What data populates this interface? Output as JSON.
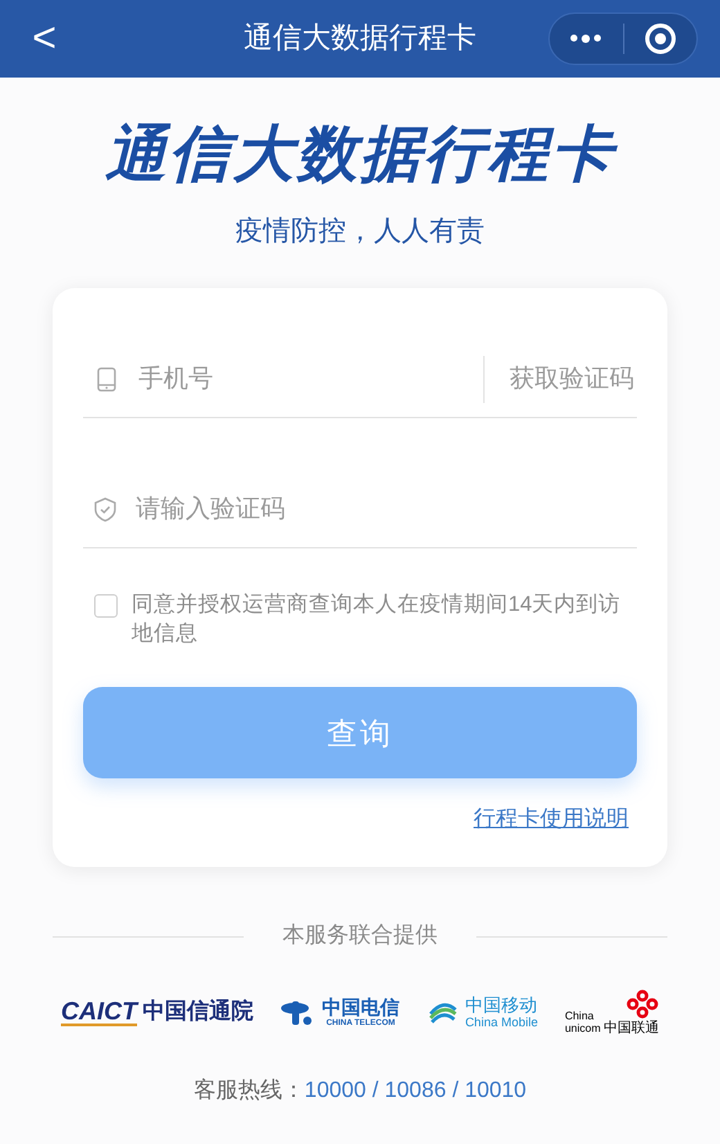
{
  "nav_bar": {
    "back": "<",
    "title": "通信大数据行程卡"
  },
  "header": {
    "title": "通信大数据行程卡",
    "slogan": "疫情防控，人人有责"
  },
  "form": {
    "phone": {
      "placeholder": "手机号"
    },
    "get_code": "获取验证码",
    "code": {
      "placeholder": "请输入验证码"
    },
    "consent": {
      "label": "同意并授权运营商查询本人在疫情期间14天内到访地信息",
      "checked": false
    },
    "submit": "查询",
    "help_link": "行程卡使用说明"
  },
  "footer": {
    "caption": "本服务联合提供",
    "providers": [
      {
        "kind": "caict",
        "texts": [
          "CAICT",
          "中国信通院"
        ]
      },
      {
        "kind": "telecom",
        "texts": [
          "中国电信",
          "CHINA TELECOM"
        ]
      },
      {
        "kind": "mobile",
        "texts": [
          "中国移动",
          "China Mobile"
        ]
      },
      {
        "kind": "unicom",
        "texts": [
          "China",
          "unicom",
          "中国联通"
        ]
      }
    ],
    "hotline_label": "客服热线：",
    "hotline_numbers": "10000 / 10086 / 10010"
  }
}
